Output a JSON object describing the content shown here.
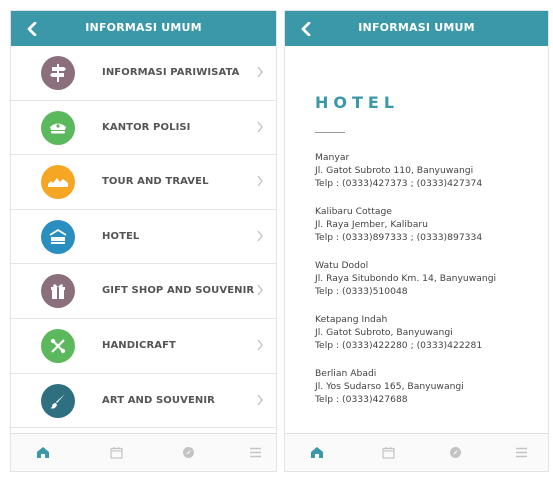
{
  "left_screen": {
    "header": {
      "title": "INFORMASI UMUM"
    },
    "menu": [
      {
        "label": "INFORMASI PARIWISATA",
        "color": "#8b6f7c",
        "icon": "signpost-icon"
      },
      {
        "label": "KANTOR POLISI",
        "color": "#5cb85c",
        "icon": "police-cap-icon"
      },
      {
        "label": "TOUR AND TRAVEL",
        "color": "#f5a623",
        "icon": "travel-icon"
      },
      {
        "label": "HOTEL",
        "color": "#2a8fbf",
        "icon": "hotel-icon"
      },
      {
        "label": "GIFT SHOP AND SOUVENIR",
        "color": "#8b6f7c",
        "icon": "gift-icon"
      },
      {
        "label": "HANDICRAFT",
        "color": "#5cb85c",
        "icon": "handicraft-icon"
      },
      {
        "label": "ART AND SOUVENIR",
        "color": "#2e6f80",
        "icon": "brush-icon"
      }
    ]
  },
  "right_screen": {
    "header": {
      "title": "INFORMASI UMUM"
    },
    "section_title": "HOTEL",
    "hotels": [
      {
        "name": "Manyar",
        "address": "Jl. Gatot Subroto 110, Banyuwangi",
        "phone": "Telp : (0333)427373 ; (0333)427374"
      },
      {
        "name": "Kalibaru Cottage",
        "address": "Jl. Raya Jember, Kalibaru",
        "phone": "Telp : (0333)897333 ; (0333)897334"
      },
      {
        "name": "Watu Dodol",
        "address": "Jl. Raya Situbondo Km. 14, Banyuwangi",
        "phone": "Telp : (0333)510048"
      },
      {
        "name": "Ketapang Indah",
        "address": "Jl. Gatot Subroto, Banyuwangi",
        "phone": "Telp : (0333)422280 ; (0333)422281"
      },
      {
        "name": "Berlian Abadi",
        "address": "Jl. Yos Sudarso 165, Banyuwangi",
        "phone": "Telp : (0333)427688"
      }
    ]
  },
  "bottom_nav": {
    "items": [
      "home-icon",
      "calendar-icon",
      "compass-icon",
      "menu-icon"
    ],
    "active_color": "#3a98a8",
    "inactive_color": "#c4c4c4"
  },
  "colors": {
    "accent": "#3a98a8"
  }
}
